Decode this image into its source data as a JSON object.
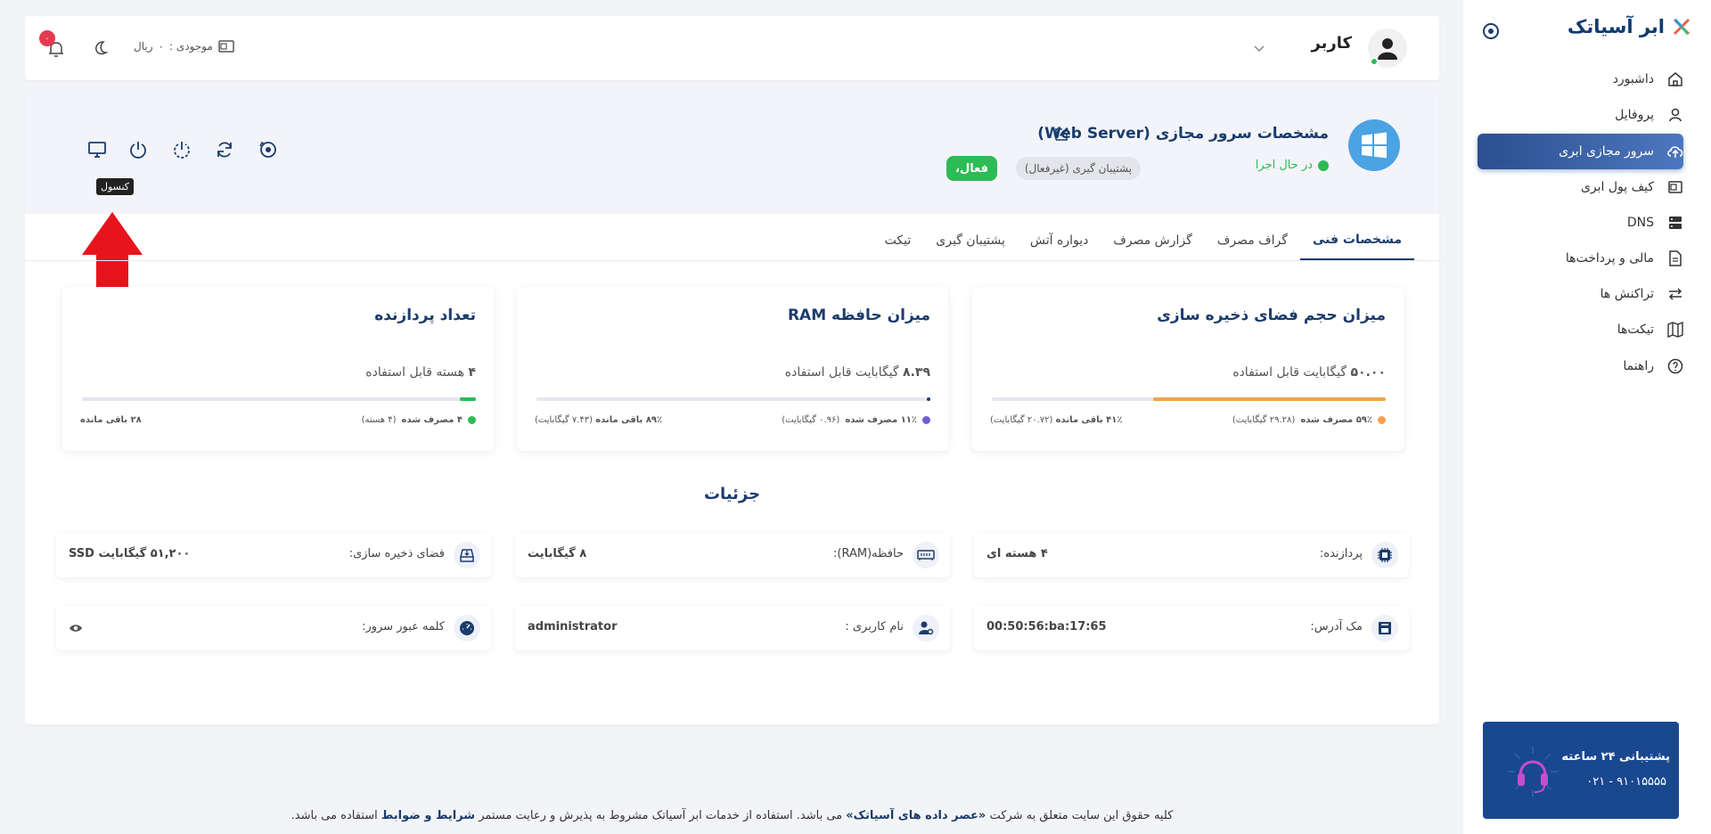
{
  "sidebar": {
    "logo_text": "ابر آسیاتک",
    "items": [
      {
        "label": "داشبورد",
        "icon": "home-icon"
      },
      {
        "label": "پروفایل",
        "icon": "user-icon"
      },
      {
        "label": "سرور مجازی ابری",
        "icon": "cloud-upload-icon",
        "active": true
      },
      {
        "label": "کیف پول ابری",
        "icon": "wallet-icon"
      },
      {
        "label": "DNS",
        "icon": "server-icon"
      },
      {
        "label": "مالی و پرداخت‌ها",
        "icon": "document-icon"
      },
      {
        "label": "تراکنش ها",
        "icon": "exchange-icon"
      },
      {
        "label": "تیکت‌ها",
        "icon": "map-icon"
      },
      {
        "label": "راهنما",
        "icon": "help-icon"
      }
    ],
    "support": {
      "title": "پشتیبانی ۲۴ ساعته",
      "phone": "۰۲۱ - ۹۱۰۱۵۵۵۵"
    }
  },
  "header": {
    "user_name": "کاربر",
    "balance_label": "موجودی :",
    "balance_value": "۰",
    "balance_unit": "ریال",
    "notification_count": "۰"
  },
  "server": {
    "title": "مشخصات سرور مجازی (Web Server)",
    "status": "در حال اجرا",
    "backup_badge": "پشتیبان گیری (غیرفعال)",
    "active_badge": "فعال،",
    "tooltip": "کنسول"
  },
  "tabs": [
    "مشخصات فنی",
    "گراف مصرف",
    "گزارش مصرف",
    "دیواره آتش",
    "پشتیبان گیری",
    "تیکت"
  ],
  "cards": [
    {
      "title": "میزان حجم فضای ذخیره سازی",
      "usable_num": "۵۰.۰۰",
      "usable_text": "گیگابایت قابل استفاده",
      "used": "۵۹٪ مصرف شده",
      "used_detail": "(۲۹.۲۸ گیگابایت)",
      "remain": "۴۱٪ باقی مانده",
      "remain_detail": "(۲۰.۷۲ گیگابایت)",
      "used_fraction": 0.59,
      "color": "#f4a24c"
    },
    {
      "title": "میزان حافظه RAM",
      "usable_num": "۸.۳۹",
      "usable_text": "گیگابایت قابل استفاده",
      "used": "۱۱٪ مصرف شده",
      "used_detail": "(۰.۹۶ گیگابایت)",
      "remain": "۸۹٪ باقی مانده",
      "remain_detail": "(۷.۴۳ گیگابایت)",
      "used_fraction": 0.01,
      "color": "#1b3c6d",
      "dot_color": "#6b5fd6"
    },
    {
      "title": "تعداد پردازنده",
      "usable_num": "۴",
      "usable_text": "هسته قابل استفاده",
      "used": "۴ مصرف شده",
      "used_detail": "(۴ هسته)",
      "remain": "۲۸ باقی مانده",
      "remain_detail": "",
      "used_fraction": 0.04,
      "color": "#2dbb55"
    }
  ],
  "details": {
    "title": "جزئیات",
    "items": [
      {
        "label": "پردازنده:",
        "value": "۴ هسته ای",
        "icon": "cpu-icon"
      },
      {
        "label": "حافظه(RAM):",
        "value": "۸ گیگابایت",
        "icon": "memory-icon"
      },
      {
        "label": "فضای ذخیره سازی:",
        "value": "۵۱,۲۰۰ گیگابایت SSD",
        "icon": "storage-icon"
      },
      {
        "label": "مک آدرس:",
        "value": "00:50:56:ba:17:65",
        "icon": "network-card-icon"
      },
      {
        "label": "نام کاربری :",
        "value": "administrator",
        "icon": "user-gear-icon"
      },
      {
        "label": "کلمه عبور سرور:",
        "value": "",
        "icon": "password-gauge-icon"
      }
    ]
  },
  "footer": {
    "part1": "کلیه حقوق این سایت متعلق به شرکت",
    "company": "«عصر داده های آسیاتک»",
    "part2": "می باشد. استفاده از خدمات ابر آسیاتک مشروط به پذیرش و رعایت مستمر",
    "terms": "شرایط و ضوابط",
    "part3": "استفاده می باشد."
  }
}
